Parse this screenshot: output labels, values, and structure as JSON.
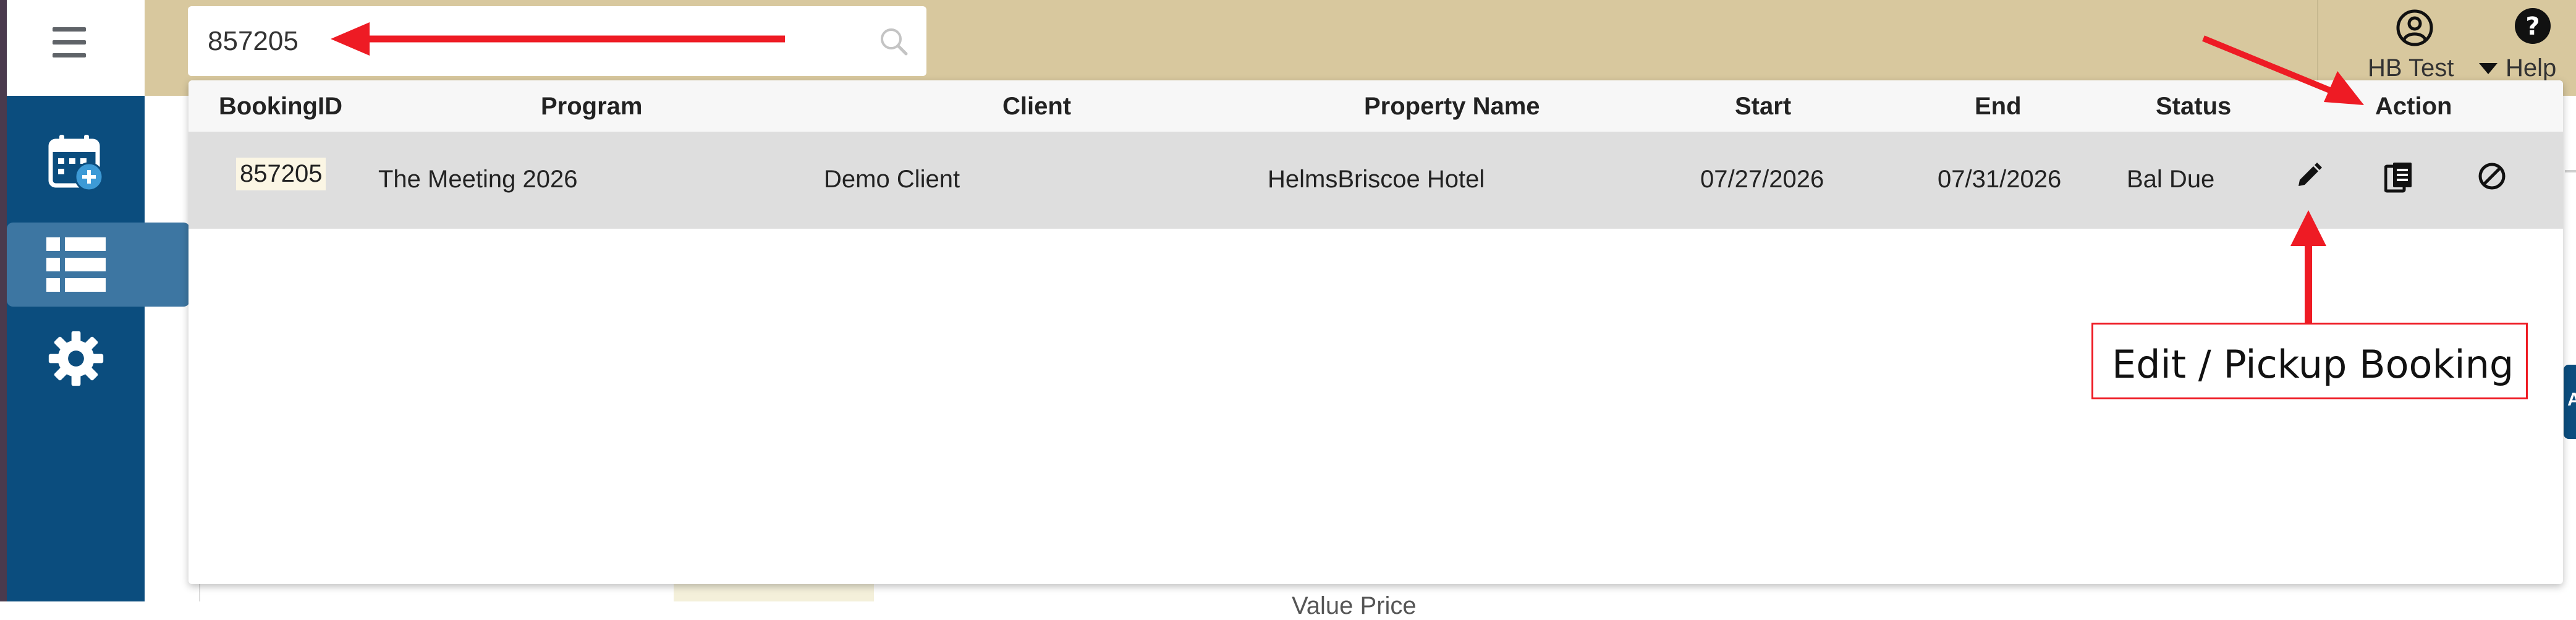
{
  "search": {
    "value": "857205"
  },
  "user": {
    "name": "HB Test",
    "help_label": "Help"
  },
  "table": {
    "headers": [
      "BookingID",
      "Program",
      "Client",
      "Property Name",
      "Start",
      "End",
      "Status",
      "Action"
    ],
    "rows": [
      {
        "booking_id": "857205",
        "program": "The Meeting 2026",
        "client": "Demo Client",
        "property": "HelmsBriscoe Hotel",
        "start": "07/27/2026",
        "end": "07/31/2026",
        "status": "Bal Due"
      }
    ]
  },
  "annotation": {
    "label": "Edit / Pickup Booking",
    "color": "#ee1b24"
  },
  "background": {
    "partial_text": "Value Price",
    "right_badge": "A"
  },
  "colors": {
    "topbar": "#d8c89e",
    "sidebar": "#0b4d7e",
    "sidebar_active": "#3d76a2"
  },
  "icons": [
    "menu-icon",
    "calendar-add-icon",
    "list-icon",
    "gear-icon",
    "search-icon",
    "user-circle-icon",
    "help-icon",
    "edit-pencil-icon",
    "copy-icon",
    "cancel-icon"
  ]
}
